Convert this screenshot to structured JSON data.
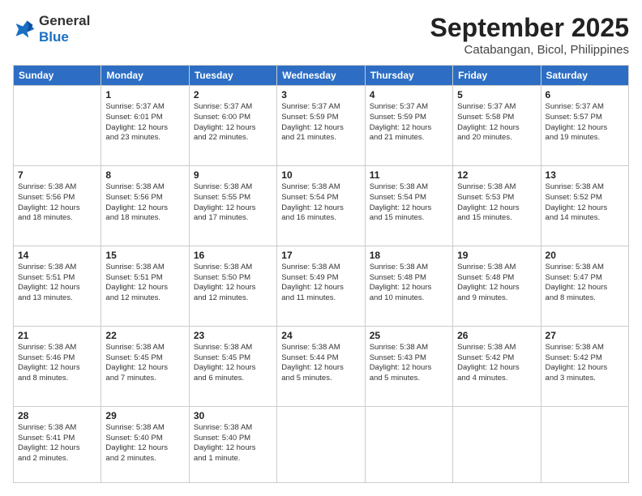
{
  "header": {
    "logo_general": "General",
    "logo_blue": "Blue",
    "month_title": "September 2025",
    "location": "Catabangan, Bicol, Philippines"
  },
  "weekdays": [
    "Sunday",
    "Monday",
    "Tuesday",
    "Wednesday",
    "Thursday",
    "Friday",
    "Saturday"
  ],
  "weeks": [
    [
      {
        "day": "",
        "info": ""
      },
      {
        "day": "1",
        "info": "Sunrise: 5:37 AM\nSunset: 6:01 PM\nDaylight: 12 hours\nand 23 minutes."
      },
      {
        "day": "2",
        "info": "Sunrise: 5:37 AM\nSunset: 6:00 PM\nDaylight: 12 hours\nand 22 minutes."
      },
      {
        "day": "3",
        "info": "Sunrise: 5:37 AM\nSunset: 5:59 PM\nDaylight: 12 hours\nand 21 minutes."
      },
      {
        "day": "4",
        "info": "Sunrise: 5:37 AM\nSunset: 5:59 PM\nDaylight: 12 hours\nand 21 minutes."
      },
      {
        "day": "5",
        "info": "Sunrise: 5:37 AM\nSunset: 5:58 PM\nDaylight: 12 hours\nand 20 minutes."
      },
      {
        "day": "6",
        "info": "Sunrise: 5:37 AM\nSunset: 5:57 PM\nDaylight: 12 hours\nand 19 minutes."
      }
    ],
    [
      {
        "day": "7",
        "info": "Sunrise: 5:38 AM\nSunset: 5:56 PM\nDaylight: 12 hours\nand 18 minutes."
      },
      {
        "day": "8",
        "info": "Sunrise: 5:38 AM\nSunset: 5:56 PM\nDaylight: 12 hours\nand 18 minutes."
      },
      {
        "day": "9",
        "info": "Sunrise: 5:38 AM\nSunset: 5:55 PM\nDaylight: 12 hours\nand 17 minutes."
      },
      {
        "day": "10",
        "info": "Sunrise: 5:38 AM\nSunset: 5:54 PM\nDaylight: 12 hours\nand 16 minutes."
      },
      {
        "day": "11",
        "info": "Sunrise: 5:38 AM\nSunset: 5:54 PM\nDaylight: 12 hours\nand 15 minutes."
      },
      {
        "day": "12",
        "info": "Sunrise: 5:38 AM\nSunset: 5:53 PM\nDaylight: 12 hours\nand 15 minutes."
      },
      {
        "day": "13",
        "info": "Sunrise: 5:38 AM\nSunset: 5:52 PM\nDaylight: 12 hours\nand 14 minutes."
      }
    ],
    [
      {
        "day": "14",
        "info": "Sunrise: 5:38 AM\nSunset: 5:51 PM\nDaylight: 12 hours\nand 13 minutes."
      },
      {
        "day": "15",
        "info": "Sunrise: 5:38 AM\nSunset: 5:51 PM\nDaylight: 12 hours\nand 12 minutes."
      },
      {
        "day": "16",
        "info": "Sunrise: 5:38 AM\nSunset: 5:50 PM\nDaylight: 12 hours\nand 12 minutes."
      },
      {
        "day": "17",
        "info": "Sunrise: 5:38 AM\nSunset: 5:49 PM\nDaylight: 12 hours\nand 11 minutes."
      },
      {
        "day": "18",
        "info": "Sunrise: 5:38 AM\nSunset: 5:48 PM\nDaylight: 12 hours\nand 10 minutes."
      },
      {
        "day": "19",
        "info": "Sunrise: 5:38 AM\nSunset: 5:48 PM\nDaylight: 12 hours\nand 9 minutes."
      },
      {
        "day": "20",
        "info": "Sunrise: 5:38 AM\nSunset: 5:47 PM\nDaylight: 12 hours\nand 8 minutes."
      }
    ],
    [
      {
        "day": "21",
        "info": "Sunrise: 5:38 AM\nSunset: 5:46 PM\nDaylight: 12 hours\nand 8 minutes."
      },
      {
        "day": "22",
        "info": "Sunrise: 5:38 AM\nSunset: 5:45 PM\nDaylight: 12 hours\nand 7 minutes."
      },
      {
        "day": "23",
        "info": "Sunrise: 5:38 AM\nSunset: 5:45 PM\nDaylight: 12 hours\nand 6 minutes."
      },
      {
        "day": "24",
        "info": "Sunrise: 5:38 AM\nSunset: 5:44 PM\nDaylight: 12 hours\nand 5 minutes."
      },
      {
        "day": "25",
        "info": "Sunrise: 5:38 AM\nSunset: 5:43 PM\nDaylight: 12 hours\nand 5 minutes."
      },
      {
        "day": "26",
        "info": "Sunrise: 5:38 AM\nSunset: 5:42 PM\nDaylight: 12 hours\nand 4 minutes."
      },
      {
        "day": "27",
        "info": "Sunrise: 5:38 AM\nSunset: 5:42 PM\nDaylight: 12 hours\nand 3 minutes."
      }
    ],
    [
      {
        "day": "28",
        "info": "Sunrise: 5:38 AM\nSunset: 5:41 PM\nDaylight: 12 hours\nand 2 minutes."
      },
      {
        "day": "29",
        "info": "Sunrise: 5:38 AM\nSunset: 5:40 PM\nDaylight: 12 hours\nand 2 minutes."
      },
      {
        "day": "30",
        "info": "Sunrise: 5:38 AM\nSunset: 5:40 PM\nDaylight: 12 hours\nand 1 minute."
      },
      {
        "day": "",
        "info": ""
      },
      {
        "day": "",
        "info": ""
      },
      {
        "day": "",
        "info": ""
      },
      {
        "day": "",
        "info": ""
      }
    ]
  ]
}
